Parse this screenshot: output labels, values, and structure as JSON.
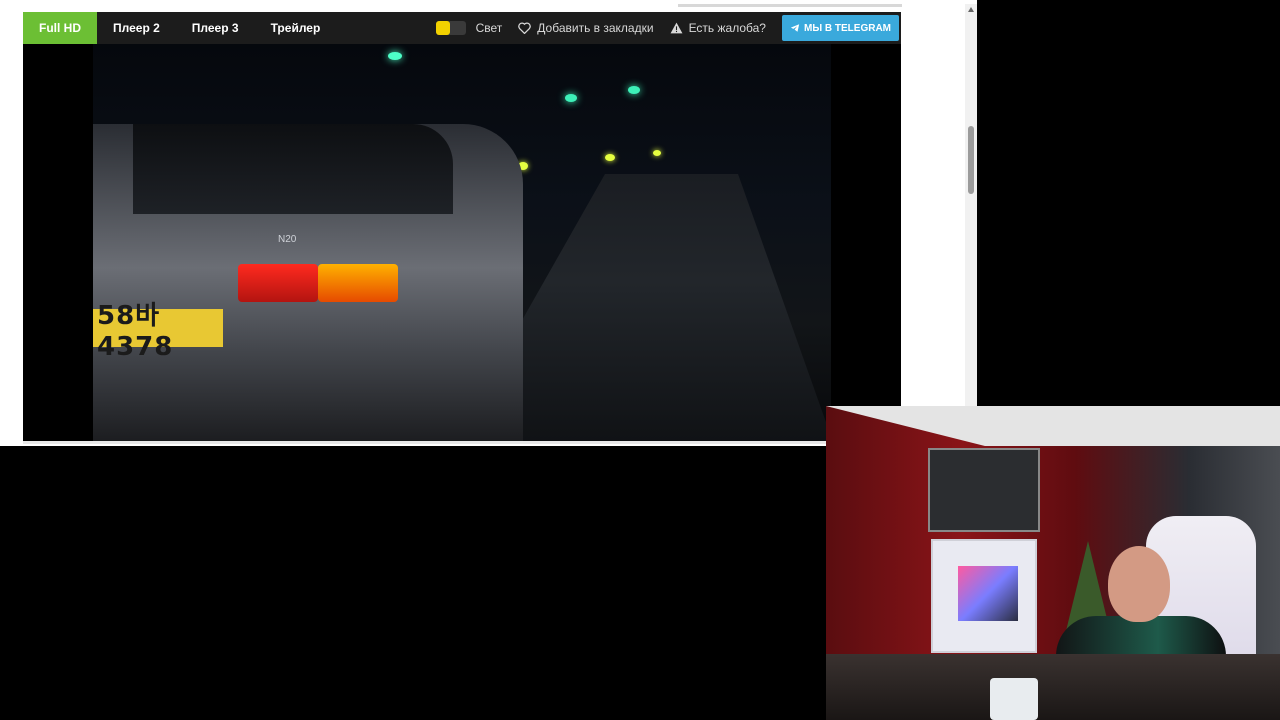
{
  "player": {
    "tabs": [
      {
        "label": "Full HD",
        "active": true
      },
      {
        "label": "Плеер 2",
        "active": false
      },
      {
        "label": "Плеер 3",
        "active": false
      },
      {
        "label": "Трейлер",
        "active": false
      }
    ],
    "light_label": "Свет",
    "bookmark_label": "Добавить в закладки",
    "complaint_label": "Есть жалоба?",
    "telegram_label": "МЫ В TELEGRAM",
    "video": {
      "plate_text": "58바4378",
      "car_badge": "N20"
    }
  },
  "colors": {
    "active_tab": "#6cbf34",
    "telegram": "#3aa9dc",
    "light_toggle": "#f2d100"
  },
  "icons": [
    "heart-icon",
    "warning-icon",
    "telegram-icon",
    "arrow-up-icon"
  ]
}
